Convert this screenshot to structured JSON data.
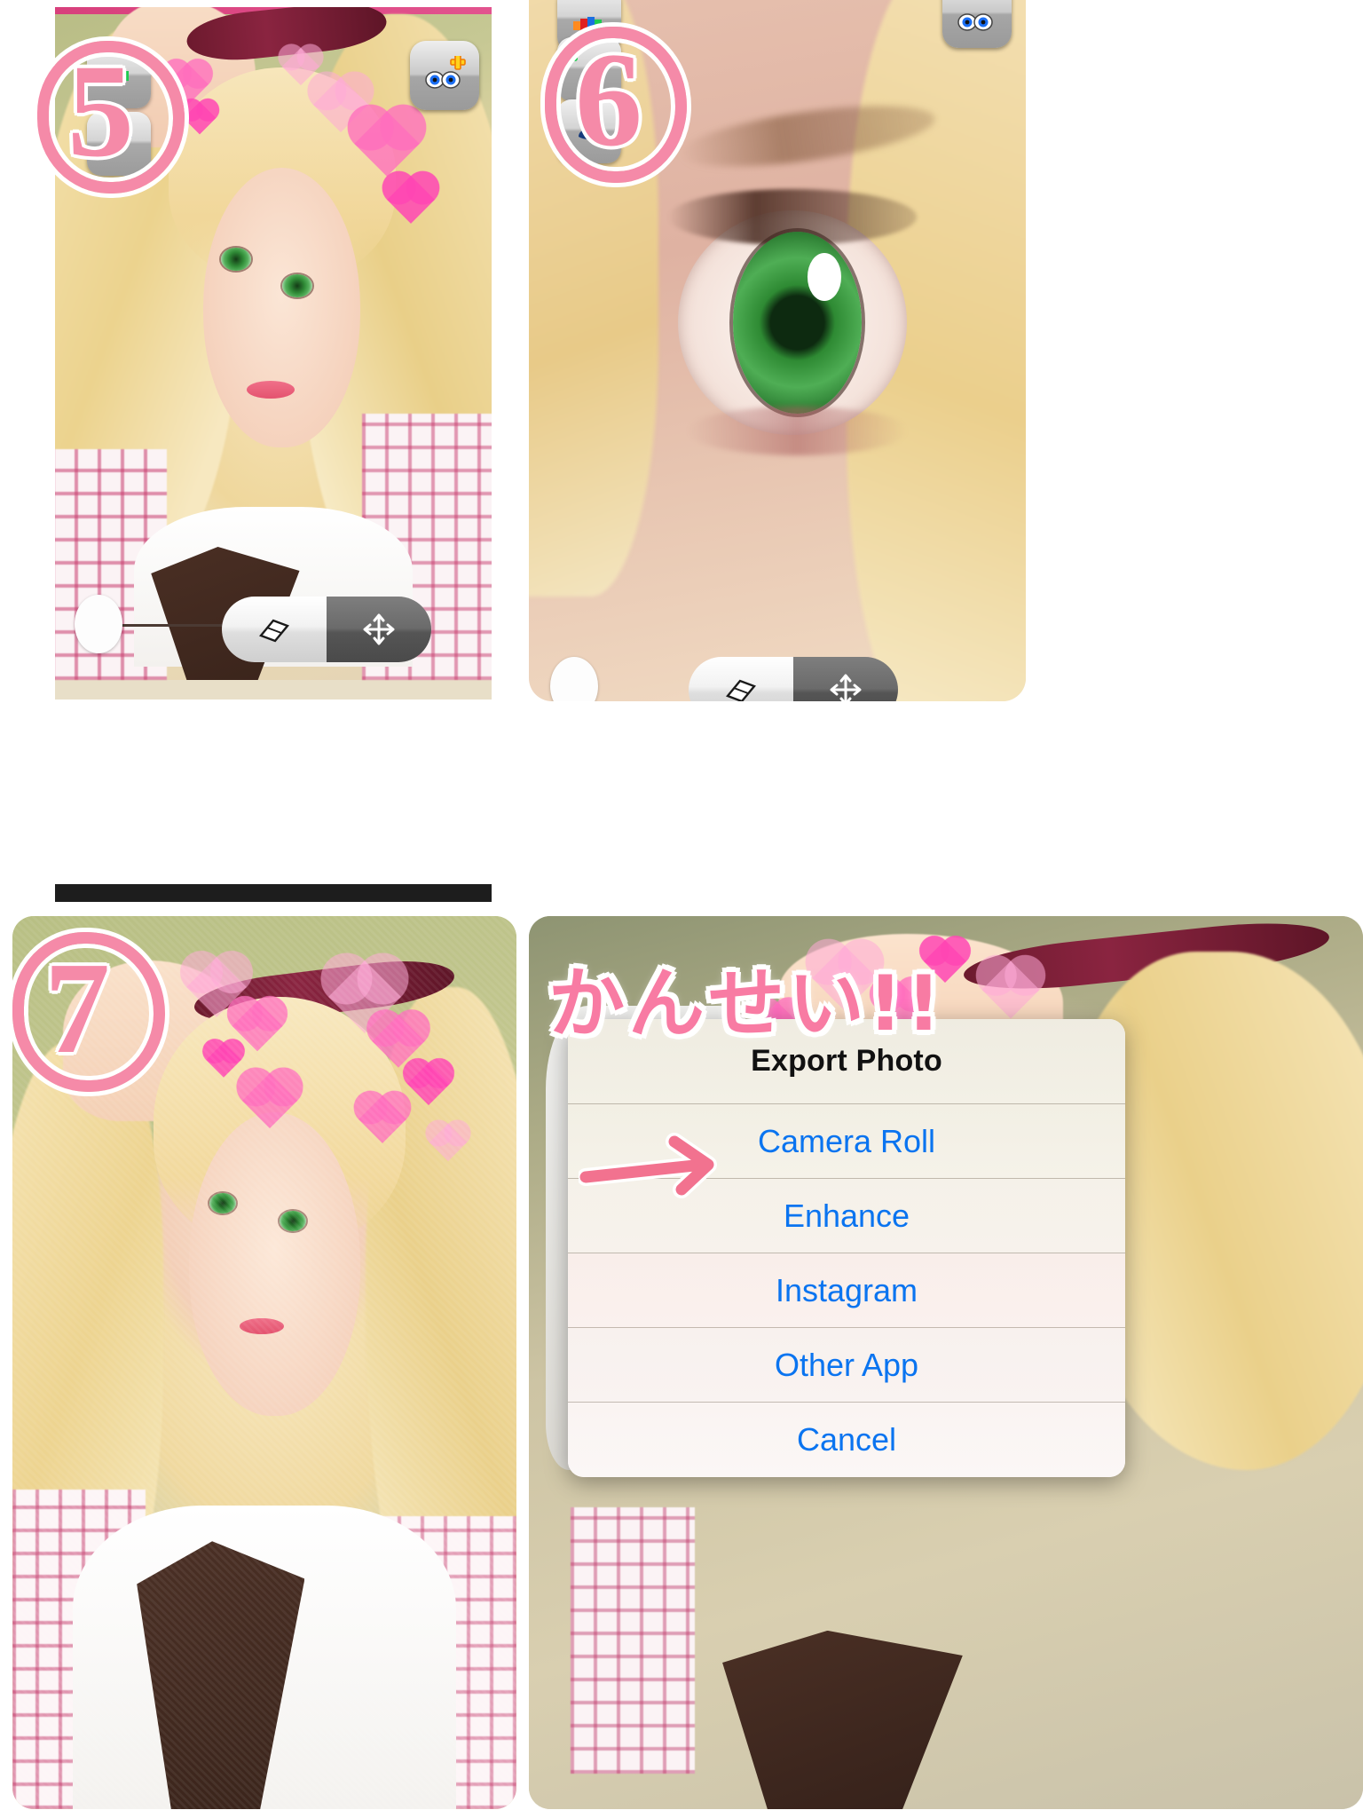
{
  "collage": {
    "title": "Photo editing app tutorial steps 5-7 with export dialog",
    "accent_pink": "#f58aa8",
    "ios_blue": "#0a74f0"
  },
  "panels": [
    {
      "id": "panel-5",
      "step_number": "5",
      "step_label": "⑤",
      "description": "Editing screen with hearts sticker overlay applied to portrait",
      "toolbar": {
        "top_buttons": [
          {
            "name": "color-palette-button",
            "label": "palette-icon"
          },
          {
            "name": "brush-button",
            "label": "brush-icon"
          }
        ],
        "top_right_button": {
          "name": "eye-enhance-button",
          "label": "eye-plus-icon"
        },
        "bottom": {
          "eraser_label": "eraser-icon",
          "move_label": "move-arrows-icon",
          "brush_size_label": "brush-size-handle"
        }
      }
    },
    {
      "id": "panel-6",
      "step_number": "6",
      "step_label": "⑥",
      "description": "Zoomed close-up of green eye being retouched",
      "toolbar": {
        "top_buttons": [
          {
            "name": "color-palette-button",
            "label": "palette-icon"
          },
          {
            "name": "eye-tool-button",
            "label": "eye-icon"
          }
        ],
        "top_right_button": {
          "name": "eye-enhance-button",
          "label": "eye-plus-icon"
        },
        "bottom": {
          "eraser_label": "eraser-icon",
          "move_label": "move-arrows-icon",
          "brush_size_label": "brush-size-handle"
        }
      }
    },
    {
      "id": "panel-7",
      "step_number": "7",
      "step_label": "⑦",
      "description": "Finished edited portrait with pink heart stickers"
    },
    {
      "id": "panel-8",
      "annotation_text": "かんせい!!",
      "description": "Export Photo action sheet shown over the finished photo"
    }
  ],
  "export_dialog": {
    "title": "Export Photo",
    "options": [
      {
        "label": "Camera Roll",
        "highlighted": true
      },
      {
        "label": "Enhance",
        "highlighted": false
      },
      {
        "label": "Instagram",
        "highlighted": false
      },
      {
        "label": "Other App",
        "highlighted": false
      },
      {
        "label": "Cancel",
        "highlighted": false
      }
    ]
  }
}
